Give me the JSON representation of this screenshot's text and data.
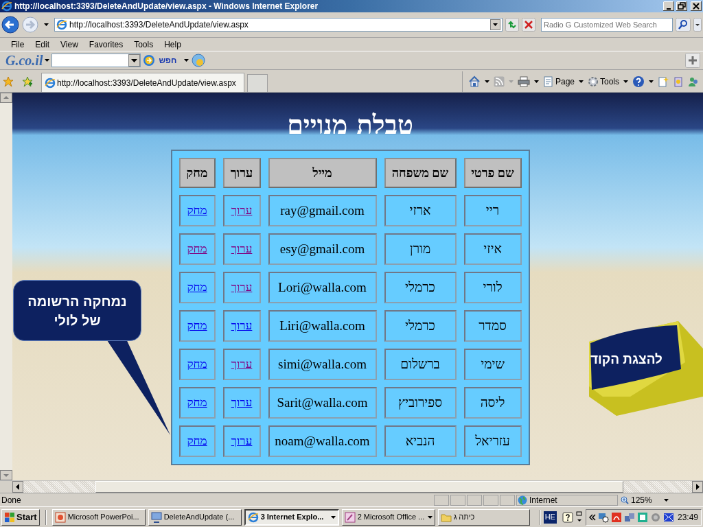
{
  "window": {
    "title": "http://localhost:3393/DeleteAndUpdate/view.aspx - Windows Internet Explorer"
  },
  "address_bar": {
    "value": "http://localhost:3393/DeleteAndUpdate/view.aspx"
  },
  "search": {
    "placeholder": "Radio G Customized Web Search"
  },
  "menu": {
    "file": "File",
    "edit": "Edit",
    "view": "View",
    "favorites": "Favorites",
    "tools": "Tools",
    "help": "Help"
  },
  "links_toolbar": {
    "logo": "G.co.il",
    "search_button": "חפש"
  },
  "tab": {
    "label": "http://localhost:3393/DeleteAndUpdate/view.aspx"
  },
  "command_bar": {
    "page": "Page",
    "tools": "Tools"
  },
  "page": {
    "title": "טבלת מנויים",
    "table": {
      "columns": [
        "שם פרטי",
        "שם משפחה",
        "מייל",
        "ערוך",
        "מחק"
      ],
      "rows": [
        {
          "first_name": "ריי",
          "last_name": "ארזי",
          "email": "ray@gmail.com",
          "edit": {
            "label": "ערוך",
            "visited": true
          },
          "delete": {
            "label": "מחק",
            "visited": false
          }
        },
        {
          "first_name": "איזי",
          "last_name": "מורן",
          "email": "esy@gmail.com",
          "edit": {
            "label": "ערוך",
            "visited": true
          },
          "delete": {
            "label": "מחק",
            "visited": true
          }
        },
        {
          "first_name": "לורי",
          "last_name": "כרמלי",
          "email": "Lori@walla.com",
          "edit": {
            "label": "ערוך",
            "visited": true
          },
          "delete": {
            "label": "מחק",
            "visited": false
          }
        },
        {
          "first_name": "סמדר",
          "last_name": "כרמלי",
          "email": "Liri@walla.com",
          "edit": {
            "label": "ערוך",
            "visited": false
          },
          "delete": {
            "label": "מחק",
            "visited": false
          }
        },
        {
          "first_name": "שימי",
          "last_name": "ברשלום",
          "email": "simi@walla.com",
          "edit": {
            "label": "ערוך",
            "visited": true
          },
          "delete": {
            "label": "מחק",
            "visited": false
          }
        },
        {
          "first_name": "ליסה",
          "last_name": "ספירוביץ",
          "email": "Sarit@walla.com",
          "edit": {
            "label": "ערוך",
            "visited": false
          },
          "delete": {
            "label": "מחק",
            "visited": false
          }
        },
        {
          "first_name": "עזריאל",
          "last_name": "הנביא",
          "email": "noam@walla.com",
          "edit": {
            "label": "ערוך",
            "visited": false
          },
          "delete": {
            "label": "מחק",
            "visited": false
          }
        }
      ]
    },
    "callout": "נמחקה הרשומה של לולי",
    "code_banner": "להצגת הקוד"
  },
  "status_bar": {
    "text": "Done",
    "zone": "Internet",
    "zoom": "125%"
  },
  "taskbar": {
    "start": "Start",
    "buttons": {
      "presentation": {
        "label": "Microsoft PowerPoi...",
        "selected": false,
        "grouped": false
      },
      "project": {
        "label": "DeleteAndUpdate (...",
        "selected": false,
        "grouped": false
      },
      "browser": {
        "label": "3 Internet Explo...",
        "selected": true,
        "grouped": true
      },
      "office": {
        "label": "2 Microsoft Office ...",
        "selected": false,
        "grouped": true
      },
      "folder": {
        "label": "כיתה ג",
        "selected": false,
        "grouped": false
      }
    },
    "language": "HE",
    "time": "23:49"
  }
}
